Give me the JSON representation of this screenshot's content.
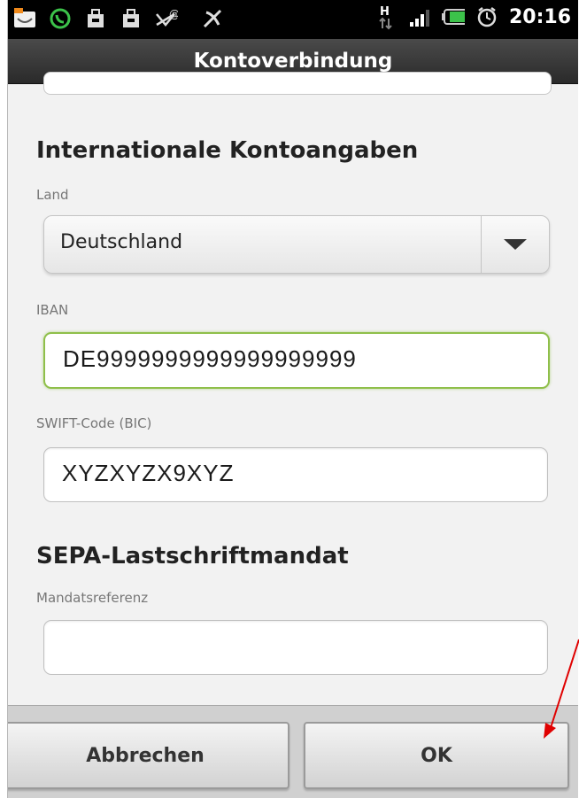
{
  "status_bar": {
    "time": "20:16",
    "network_type": "H",
    "icons": [
      "notification-icon",
      "whatsapp-icon",
      "bag-icon",
      "bag-icon",
      "missed-email-icon",
      "no-signal-tool-icon",
      "hspa-icon",
      "signal-bars-icon",
      "battery-icon",
      "alarm-icon"
    ]
  },
  "title_bar": {
    "title": "Kontoverbindung"
  },
  "international": {
    "heading": "Internationale Kontoangaben",
    "country_label": "Land",
    "country_value": "Deutschland",
    "iban_label": "IBAN",
    "iban_value": "DE9999999999999999999",
    "swift_label": "SWIFT-Code (BIC)",
    "swift_value": "XYZXYZX9XYZ"
  },
  "sepa": {
    "heading": "SEPA-Lastschriftmandat",
    "mandate_label": "Mandatsreferenz",
    "mandate_value": ""
  },
  "buttons": {
    "cancel_label": "Abbrechen",
    "ok_label": "OK"
  },
  "colors": {
    "focus_border": "#8fbf4a",
    "arrow": "#e00000",
    "title_bar": "#3a3a3a"
  }
}
